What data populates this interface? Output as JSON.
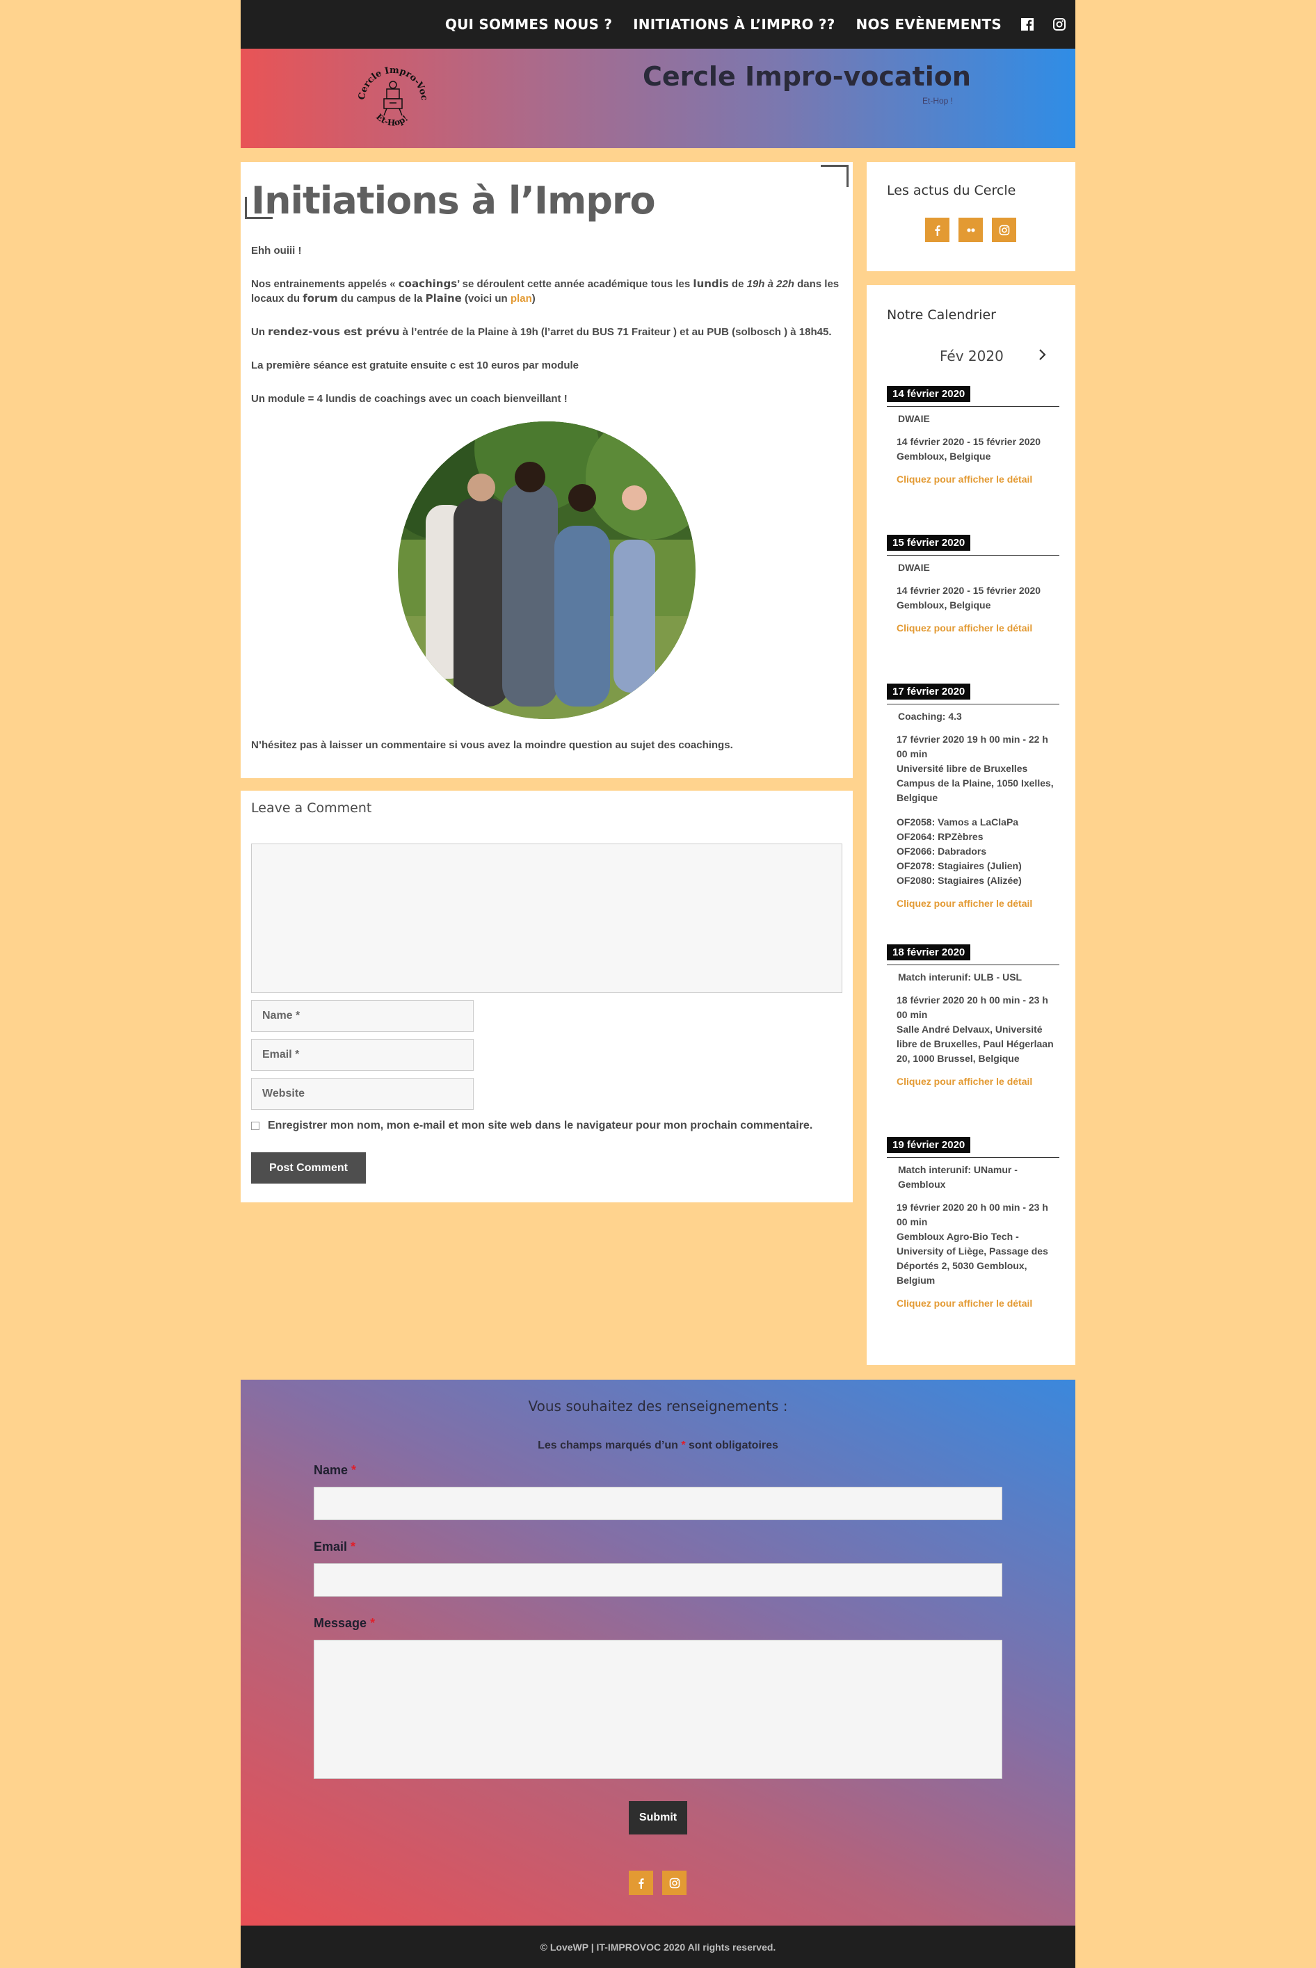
{
  "nav": {
    "items": [
      "QUI SOMMES NOUS ?",
      "INITIATIONS À L’IMPRO ??",
      "NOS EVÈNEMENTS"
    ],
    "social": [
      "facebook-icon",
      "instagram-icon"
    ]
  },
  "header": {
    "site_title": "Cercle Impro-vocation",
    "tagline": "Et-Hop !",
    "logo_text_top": "Cercle Impro-Vocation",
    "logo_text_bottom": "Et-Hop!"
  },
  "main": {
    "title": "Initiations à l’Impro",
    "p1": "Ehh ouiii !",
    "p2_a": "Nos entrainements appelés « ",
    "p2_coachings": "coachings",
    "p2_b": "’ se déroulent cette année académique tous les ",
    "p2_lundis": "lundis",
    "p2_c": " de ",
    "p2_time": "19h à 22h",
    "p2_d": " dans les locaux du ",
    "p2_forum": "forum",
    "p2_e": " du campus de la ",
    "p2_plaine": "Plaine",
    "p2_f": " (voici un ",
    "p2_plan": "plan",
    "p2_g": ")",
    "p3_a": "Un ",
    "p3_rdv": "rendez-vous est prévu",
    "p3_b": " à l’entrée de la Plaine à 19h (l’arret du BUS 71 Fraiteur ) et au PUB (solbosch ) à 18h45.",
    "p4": "La première séance est gratuite ensuite c est 10 euros par module",
    "p5": "Un module = 4 lundis de coachings avec un coach bienveillant !",
    "p6": "N’hésitez pas à laisser un commentaire si vous avez la moindre question au sujet des coachings."
  },
  "comments": {
    "heading": "Leave a Comment",
    "name_placeholder": "Name *",
    "email_placeholder": "Email *",
    "website_placeholder": "Website",
    "consent": "Enregistrer mon nom, mon e-mail et mon site web dans le navigateur pour mon prochain commentaire.",
    "submit": "Post Comment"
  },
  "sidebar": {
    "news_title": "Les actus du Cercle",
    "news_social": [
      "facebook-icon",
      "flickr-icon",
      "instagram-icon"
    ],
    "calendar_title": "Notre Calendrier",
    "calendar_month": "Fév 2020",
    "detail_link": "Cliquez pour afficher le détail",
    "events": [
      {
        "date": "14 février 2020",
        "title": "DWAIE",
        "time": "14 février 2020 - 15 février 2020",
        "place": "Gembloux, Belgique"
      },
      {
        "date": "15 février 2020",
        "title": "DWAIE",
        "time": "14 février 2020 - 15 février 2020",
        "place": "Gembloux, Belgique"
      },
      {
        "date": "17 février 2020",
        "title": "Coaching: 4.3",
        "time": "17 février 2020  19 h 00 min - 22 h 00 min",
        "place": "Université libre de Bruxelles Campus de la Plaine, 1050 Ixelles, Belgique",
        "extra": [
          "OF2058: Vamos a LaClaPa",
          "OF2064: RPZèbres",
          "OF2066: Dabradors",
          "OF2078: Stagiaires (Julien)",
          "OF2080: Stagiaires (Alizée)"
        ]
      },
      {
        "date": "18 février 2020",
        "title": "Match interunif: ULB - USL",
        "time": "18 février 2020  20 h 00 min - 23 h 00 min",
        "place": "Salle André Delvaux, Université libre de Bruxelles, Paul Hégerlaan 20, 1000 Brussel, Belgique"
      },
      {
        "date": "19 février 2020",
        "title": "Match interunif: UNamur - Gembloux",
        "time": "19 février 2020  20 h 00 min - 23 h 00 min",
        "place": "Gembloux Agro-Bio Tech - University of Liège, Passage des Déportés 2, 5030 Gembloux, Belgium"
      }
    ]
  },
  "contact": {
    "heading": "Vous souhaitez des renseignements :",
    "required_a": "Les champs marqués d’un ",
    "required_star": "*",
    "required_b": " sont obligatoires",
    "name_label": "Name",
    "email_label": "Email",
    "message_label": "Message",
    "star": "*",
    "submit": "Submit",
    "social": [
      "facebook-icon",
      "instagram-icon"
    ]
  },
  "footer": {
    "copyright": "© LoveWP | IT-IMPROVOC 2020 All rights reserved."
  },
  "colors": {
    "background": "#ffd38e",
    "accent": "#e39a33",
    "dark": "#1f1f1f",
    "gradient_start": "#e85456",
    "gradient_end": "#2f8de6"
  }
}
